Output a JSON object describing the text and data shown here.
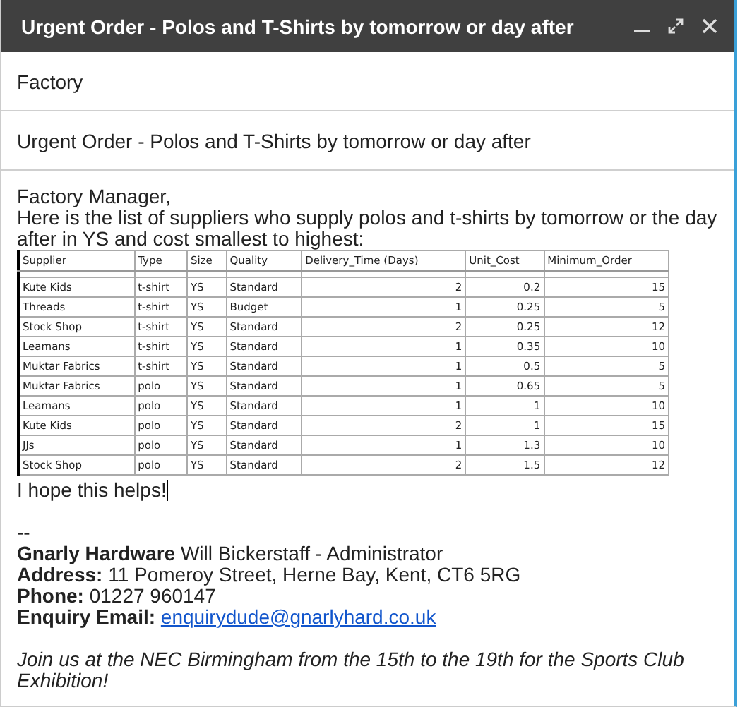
{
  "window": {
    "title": "Urgent Order - Polos and T-Shirts by tomorrow or day after"
  },
  "to": "Factory",
  "subject": "Urgent Order - Polos and T-Shirts by tomorrow or day after",
  "body": {
    "greeting": "Factory Manager,",
    "intro": "Here is the list of suppliers who supply polos and t-shirts by tomorrow or the day after in YS and cost smallest to highest:",
    "table": {
      "columns": [
        "Supplier",
        "Type",
        "Size",
        "Quality",
        "Delivery_Time (Days)",
        "Unit_Cost",
        "Minimum_Order"
      ],
      "rows": [
        [
          "Kute Kids",
          "t-shirt",
          "YS",
          "Standard",
          "2",
          "0.2",
          "15"
        ],
        [
          "Threads",
          "t-shirt",
          "YS",
          "Budget",
          "1",
          "0.25",
          "5"
        ],
        [
          "Stock Shop",
          "t-shirt",
          "YS",
          "Standard",
          "2",
          "0.25",
          "12"
        ],
        [
          "Leamans",
          "t-shirt",
          "YS",
          "Standard",
          "1",
          "0.35",
          "10"
        ],
        [
          "Muktar Fabrics",
          "t-shirt",
          "YS",
          "Standard",
          "1",
          "0.5",
          "5"
        ],
        [
          "Muktar Fabrics",
          "polo",
          "YS",
          "Standard",
          "1",
          "0.65",
          "5"
        ],
        [
          "Leamans",
          "polo",
          "YS",
          "Standard",
          "1",
          "1",
          "10"
        ],
        [
          "Kute Kids",
          "polo",
          "YS",
          "Standard",
          "2",
          "1",
          "15"
        ],
        [
          "JJs",
          "polo",
          "YS",
          "Standard",
          "1",
          "1.3",
          "10"
        ],
        [
          "Stock Shop",
          "polo",
          "YS",
          "Standard",
          "2",
          "1.5",
          "12"
        ]
      ]
    },
    "closing": "I hope this helps!"
  },
  "signature": {
    "separator": "--",
    "lines": [
      "**Gnarly Hardware** Will Bickerstaff - Administrator",
      "**Address:** 11 Pomeroy Street, Herne Bay, Kent, CT6 5RG",
      "**Phone:** 01227 960147"
    ],
    "email_label": "Enquiry Email:",
    "email": "enquirydude@gnarlyhard.co.uk",
    "note": "Join us at the NEC Birmingham from the 15th to the 19th for the Sports Club Exhibition!"
  }
}
